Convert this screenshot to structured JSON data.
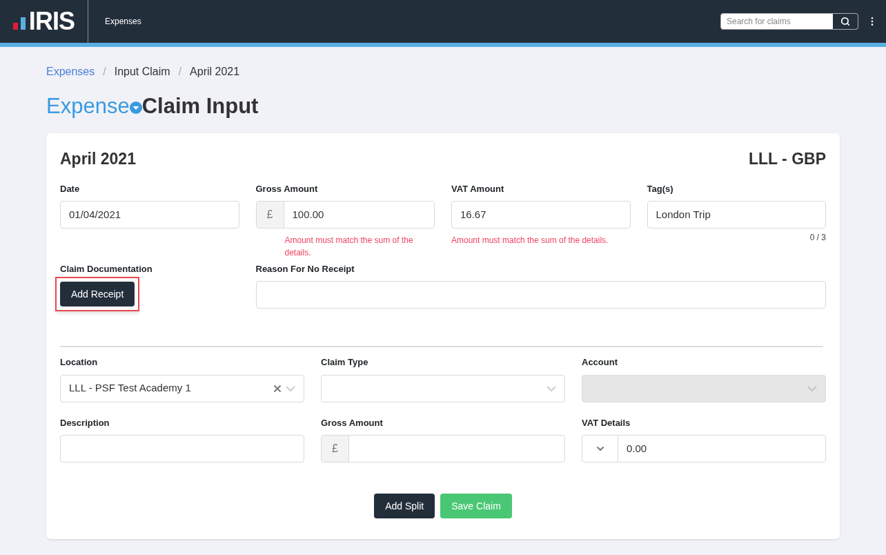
{
  "header": {
    "logo": "IRIS",
    "nav": "Expenses",
    "search": {
      "placeholder": "Search for claims"
    }
  },
  "breadcrumb": {
    "separator": "/",
    "items": [
      {
        "label": "Expenses",
        "link": true
      },
      {
        "label": "Input Claim",
        "link": false
      },
      {
        "label": "April 2021",
        "link": false
      }
    ]
  },
  "title": {
    "accent": "Expense",
    "rest": "Claim Input"
  },
  "card": {
    "period": "April 2021",
    "currency": "LLL - GBP",
    "top_fields": [
      {
        "label": "Date",
        "value": "01/04/2021"
      },
      {
        "label": "Gross Amount",
        "prefix": "£",
        "value": "100.00",
        "error": "Amount must match the sum of the details."
      },
      {
        "label": "VAT Amount",
        "value": "16.67",
        "error": "Amount must match the sum of the details."
      },
      {
        "label": "Tag(s)",
        "value": "London Trip",
        "counter": "0 / 3"
      }
    ],
    "documentation": {
      "label": "Claim Documentation",
      "button": "Add Receipt",
      "highlighted": true
    },
    "reason": {
      "label": "Reason For No Receipt"
    },
    "split_fields": [
      {
        "label": "Location",
        "kind": "select",
        "value": "LLL - PSF Test Academy 1",
        "clearable": true,
        "disabled": false
      },
      {
        "label": "Claim Type",
        "kind": "select",
        "clearable": false,
        "disabled": false
      },
      {
        "label": "Account",
        "kind": "select",
        "clearable": false,
        "disabled": true
      },
      {
        "label": "Description",
        "kind": "text"
      },
      {
        "label": "Gross Amount",
        "kind": "money",
        "prefix": "£"
      },
      {
        "label": "VAT Details",
        "kind": "vat",
        "value": "0.00"
      }
    ],
    "buttons": [
      {
        "label": "Add Split",
        "kind": "dark"
      },
      {
        "label": "Save Claim",
        "kind": "success"
      }
    ]
  }
}
